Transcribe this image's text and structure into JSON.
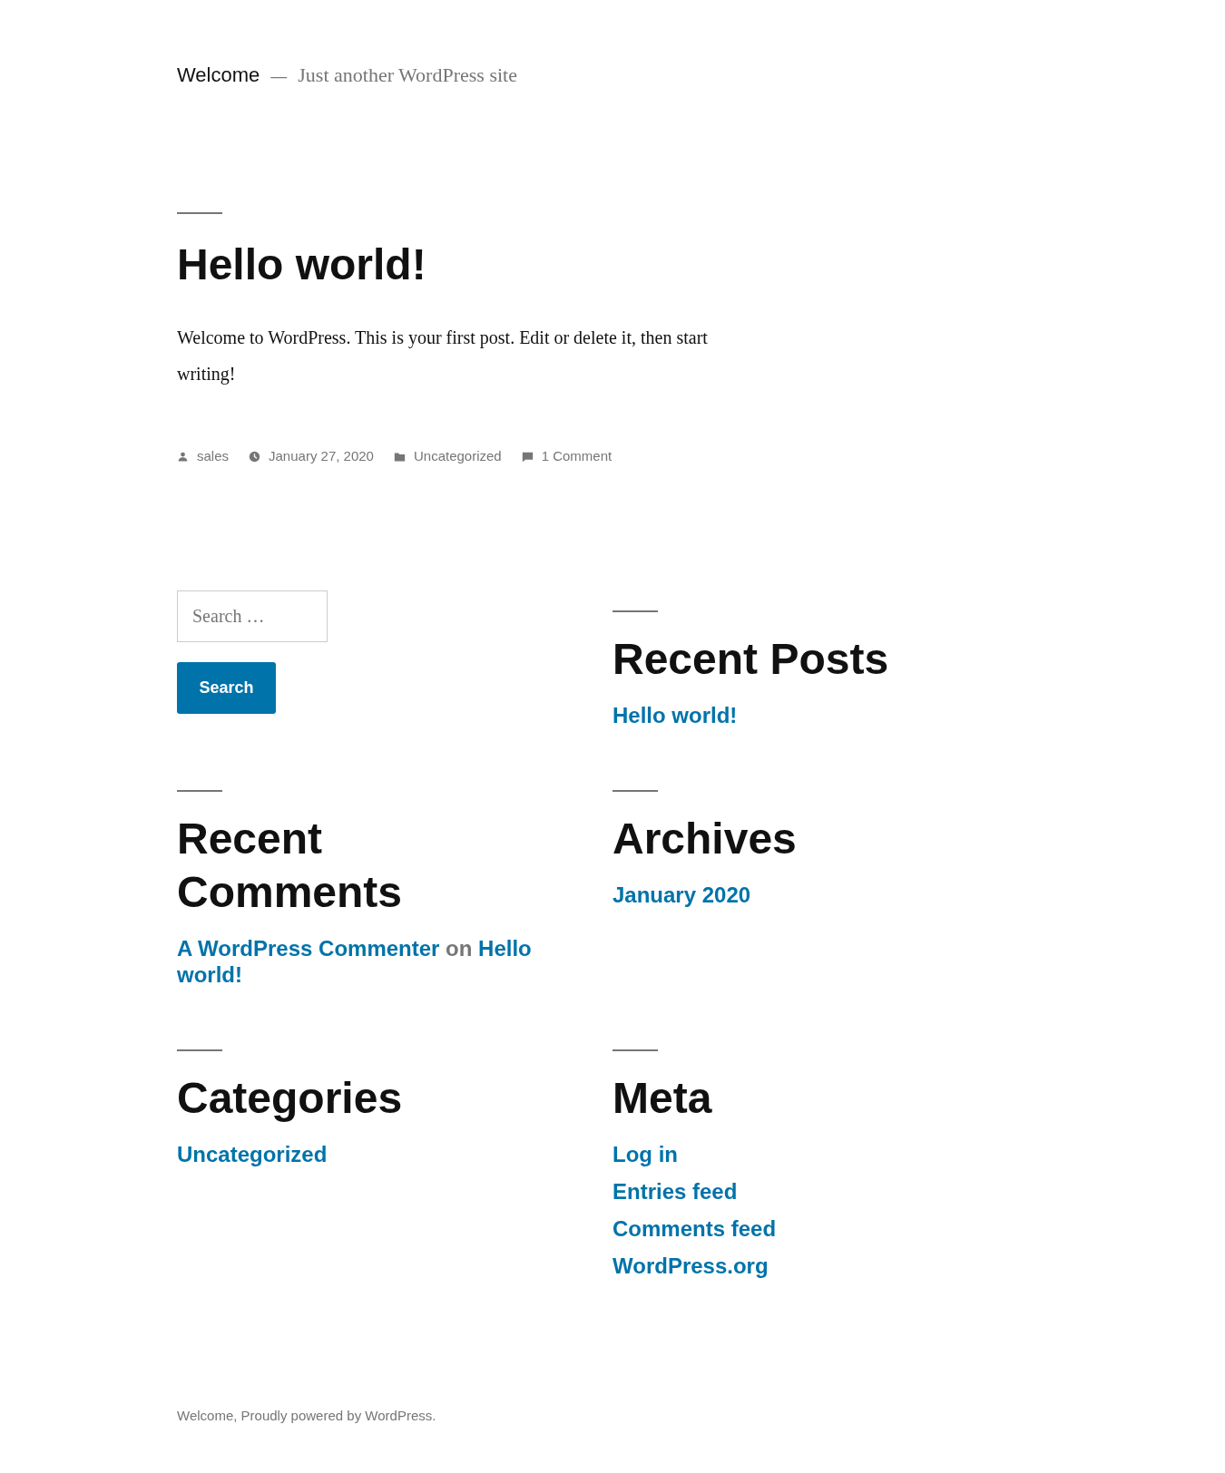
{
  "site": {
    "title": "Welcome",
    "separator": "—",
    "tagline": "Just another WordPress site"
  },
  "post": {
    "title": "Hello world!",
    "body": "Welcome to WordPress. This is your first post. Edit or delete it, then start writing!",
    "meta": [
      {
        "kind": "author",
        "text": "sales"
      },
      {
        "kind": "date",
        "text": "January 27, 2020"
      },
      {
        "kind": "category",
        "text": "Uncategorized"
      },
      {
        "kind": "comments",
        "text": "1 Comment"
      }
    ]
  },
  "widgets": [
    {
      "kind": "search",
      "placeholder": "Search …",
      "button": "Search"
    },
    {
      "kind": "list",
      "title": "Recent Posts",
      "items": [
        [
          {
            "kind": "link",
            "text": "Hello world!"
          }
        ]
      ]
    },
    {
      "kind": "list",
      "title": "Recent Comments",
      "items": [
        [
          {
            "kind": "link",
            "text": "A WordPress Commenter"
          },
          {
            "kind": "text",
            "text": "on"
          },
          {
            "kind": "link",
            "text": "Hello world!"
          }
        ]
      ]
    },
    {
      "kind": "list",
      "title": "Archives",
      "items": [
        [
          {
            "kind": "link",
            "text": "January 2020"
          }
        ]
      ]
    },
    {
      "kind": "list",
      "title": "Categories",
      "items": [
        [
          {
            "kind": "link",
            "text": "Uncategorized"
          }
        ]
      ]
    },
    {
      "kind": "list",
      "title": "Meta",
      "items": [
        [
          {
            "kind": "link",
            "text": "Log in"
          }
        ],
        [
          {
            "kind": "link",
            "text": "Entries feed"
          }
        ],
        [
          {
            "kind": "link",
            "text": "Comments feed"
          }
        ],
        [
          {
            "kind": "link",
            "text": "WordPress.org"
          }
        ]
      ]
    }
  ],
  "footer": "Welcome, Proudly powered by WordPress."
}
